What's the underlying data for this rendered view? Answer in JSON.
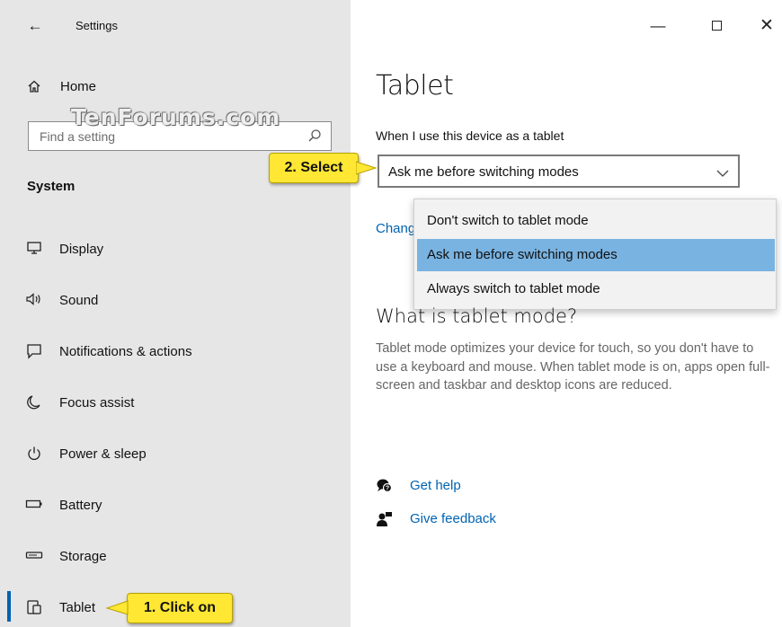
{
  "window": {
    "title": "Settings",
    "back_icon": "back-arrow-icon"
  },
  "sidebar": {
    "home_label": "Home",
    "search_placeholder": "Find a setting",
    "watermark": "TenForums.com",
    "section_label": "System",
    "items": [
      {
        "label": "Display",
        "icon": "display-icon"
      },
      {
        "label": "Sound",
        "icon": "speaker-icon"
      },
      {
        "label": "Notifications & actions",
        "icon": "notification-icon"
      },
      {
        "label": "Focus assist",
        "icon": "moon-icon"
      },
      {
        "label": "Power & sleep",
        "icon": "power-icon"
      },
      {
        "label": "Battery",
        "icon": "battery-icon"
      },
      {
        "label": "Storage",
        "icon": "storage-icon"
      },
      {
        "label": "Tablet",
        "icon": "tablet-icon",
        "selected": true
      }
    ]
  },
  "main": {
    "title": "Tablet",
    "combo_label": "When I use this device as a tablet",
    "combo_value": "Ask me before switching modes",
    "change_link": "Chang",
    "dropdown_options": [
      {
        "label": "Don't switch to tablet mode",
        "selected": false
      },
      {
        "label": "Ask me before switching modes",
        "selected": true
      },
      {
        "label": "Always switch to tablet mode",
        "selected": false
      }
    ],
    "section_title": "What is tablet mode?",
    "section_description": "Tablet mode optimizes your device for touch, so you don't have to use a keyboard and mouse. When tablet mode is on, apps open full-screen and taskbar and desktop icons are reduced.",
    "get_help": "Get help",
    "give_feedback": "Give feedback"
  },
  "callouts": {
    "step1": "1. Click on",
    "step2": "2. Select"
  },
  "colors": {
    "accent": "#0063b1",
    "sidebar_bg": "#e6e6e6",
    "dropdown_selected": "#79b3e1",
    "callout_bg": "#ffe733"
  }
}
